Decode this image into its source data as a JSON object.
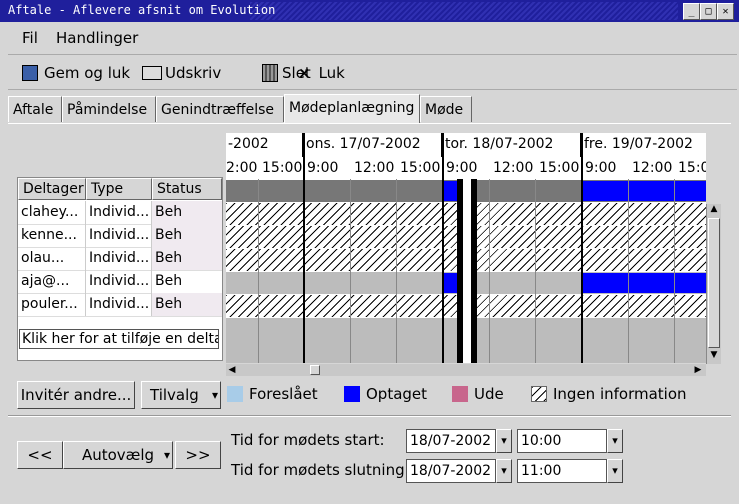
{
  "window": {
    "title": "Aftale - Aflevere afsnit om Evolution"
  },
  "menu": {
    "file": "Fil",
    "actions": "Handlinger"
  },
  "toolbar": {
    "save_close": "Gem og luk",
    "print": "Udskriv",
    "delete": "Slet",
    "close": "Luk"
  },
  "tabs": [
    "Aftale",
    "Påmindelse",
    "Genindtræffelse",
    "Mødeplanlægning",
    "Møde"
  ],
  "attendees": {
    "headers": {
      "attendee": "Deltager",
      "type": "Type",
      "status": "Status"
    },
    "rows": [
      {
        "name": "clahey...",
        "type": "Individ...",
        "status": "Beh"
      },
      {
        "name": "kenne...",
        "type": "Individ...",
        "status": "Beh"
      },
      {
        "name": "olau...",
        "type": "Individ...",
        "status": "Beh"
      },
      {
        "name": "aja@...",
        "type": "Individ...",
        "status": "Beh"
      },
      {
        "name": "pouler...",
        "type": "Individ...",
        "status": "Beh"
      }
    ],
    "add_hint": "Klik her for at tilføje en deltager"
  },
  "schedule": {
    "dates": [
      "-2002",
      "ons. 17/07-2002",
      "tor. 18/07-2002",
      "fre. 19/07-2002"
    ],
    "times": [
      "2:00",
      "15:00",
      "9:00",
      "12:00",
      "15:00",
      "9:00",
      "12:00",
      "15:00",
      "9:00",
      "12:00",
      "15:0"
    ]
  },
  "buttons": {
    "invite": "Invitér andre...",
    "options": "Tilvalg",
    "prev": "<<",
    "autopick": "Autovælg",
    "next": ">>"
  },
  "legend": {
    "tentative": "Foreslået",
    "busy": "Optaget",
    "out": "Ude",
    "noinfo": "Ingen information"
  },
  "colors": {
    "tentative": "#a8cce8",
    "busy": "#0000ff",
    "out": "#c8668c",
    "titlebar": "#1f1f9c"
  },
  "meeting": {
    "start_label": "Tid for mødets start:",
    "end_label": "Tid for mødets slutning:",
    "start_date": "18/07-2002",
    "start_time": "10:00",
    "end_date": "18/07-2002",
    "end_time": "11:00"
  }
}
